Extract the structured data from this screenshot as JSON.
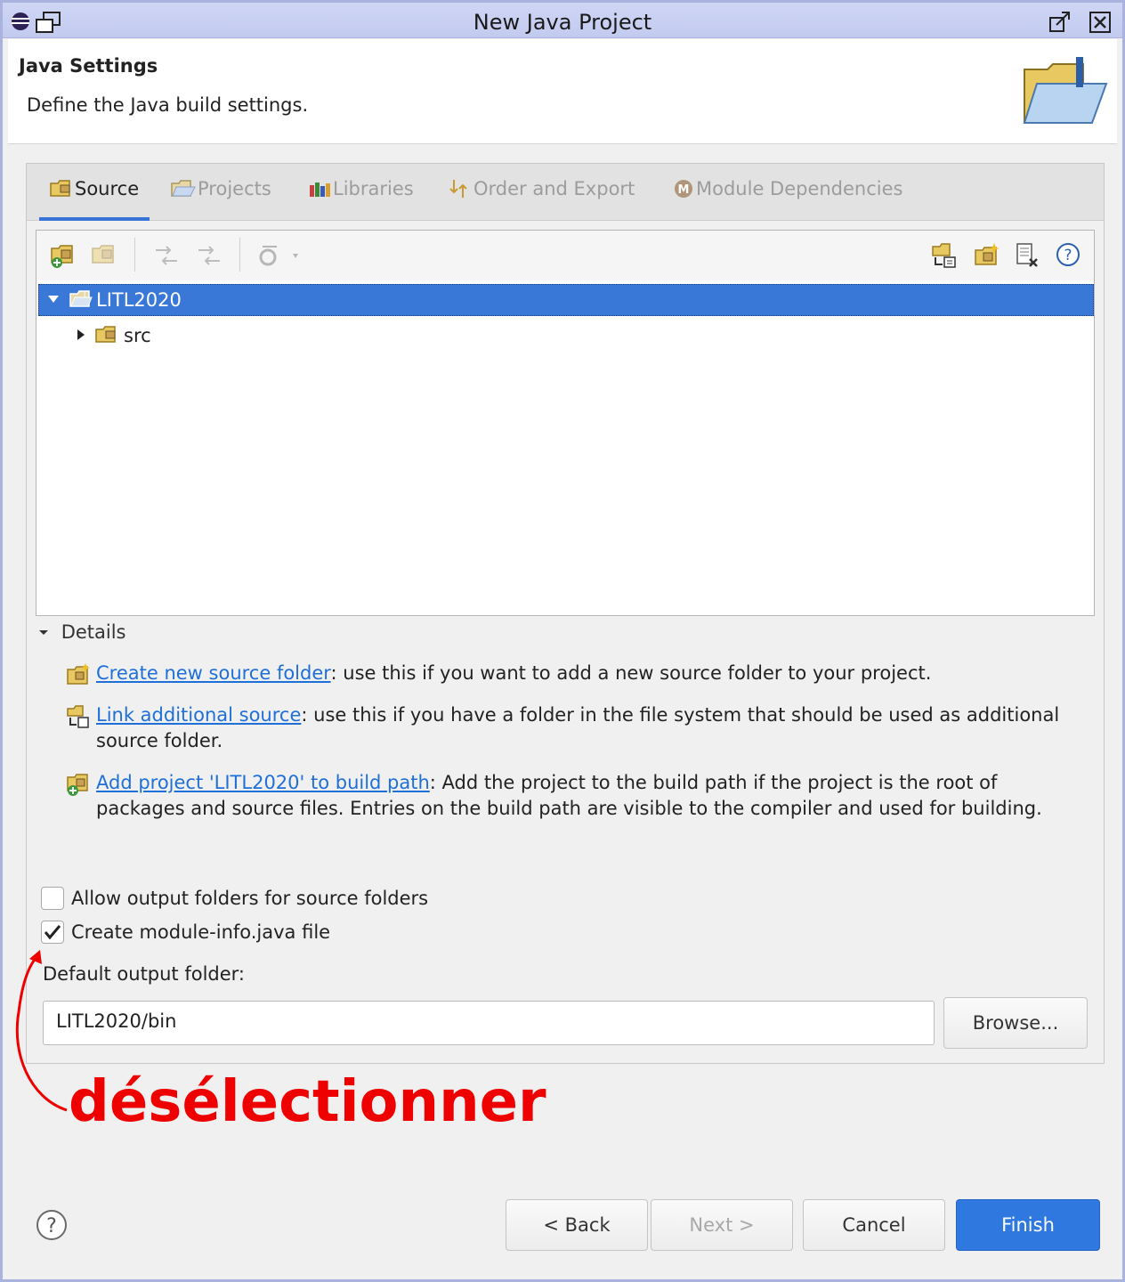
{
  "window": {
    "title": "New Java Project"
  },
  "header": {
    "heading": "Java Settings",
    "description": "Define the Java build settings."
  },
  "tabs": [
    {
      "label": "Source",
      "active": true
    },
    {
      "label": "Projects",
      "active": false
    },
    {
      "label": "Libraries",
      "active": false
    },
    {
      "label": "Order and Export",
      "active": false
    },
    {
      "label": "Module Dependencies",
      "active": false
    }
  ],
  "tree": [
    {
      "label": "LITL2020",
      "expanded": true,
      "selected": true
    },
    {
      "label": "src",
      "expanded": false,
      "selected": false
    }
  ],
  "details": {
    "label": "Details",
    "items": [
      {
        "link": "Create new source folder",
        "text": ": use this if you want to add a new source folder to your project."
      },
      {
        "link": "Link additional source",
        "text": ": use this if you have a folder in the file system that should be used as additional source folder."
      },
      {
        "link": "Add project 'LITL2020' to build path",
        "text": ": Add the project to the build path if the project is the root of packages and source files. Entries on the build path are visible to the compiler and used for building."
      }
    ]
  },
  "options": {
    "allow_output_label": "Allow output folders for source folders",
    "allow_output_checked": false,
    "module_info_label": "Create module-info.java file",
    "module_info_checked": true
  },
  "output": {
    "label": "Default output folder:",
    "value": "LITL2020/bin",
    "browse": "Browse..."
  },
  "buttons": {
    "back": "< Back",
    "next": "Next >",
    "cancel": "Cancel",
    "finish": "Finish"
  },
  "annotation": {
    "text": "désélectionner",
    "color": "#ee0000"
  },
  "colors": {
    "accent": "#3a78d8",
    "link": "#1f6fd8",
    "annotation": "#ee0000"
  }
}
